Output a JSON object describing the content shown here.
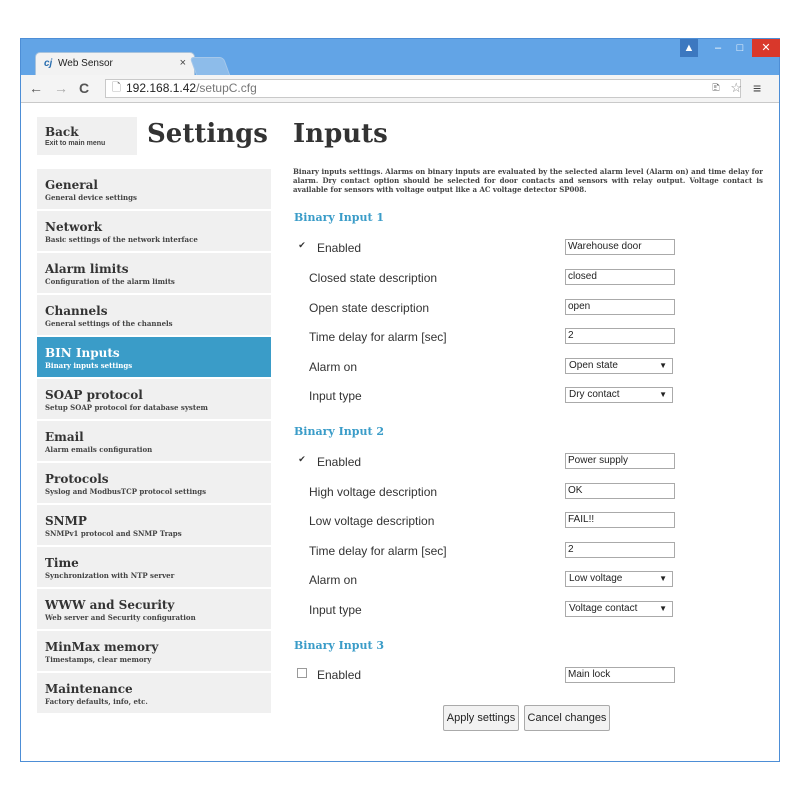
{
  "browser": {
    "tab_title": "Web Sensor",
    "tab_favicon": "cj",
    "tab_close_icon": "×",
    "back_icon": "←",
    "forward_icon": "→",
    "reload_icon": "C",
    "page_icon": "🗋",
    "url_host": "192.168.1.42",
    "url_path": "/setupC.cfg",
    "translate_icon": "🗈",
    "star_icon": "☆",
    "menu_icon": "≡",
    "user_icon": "▲",
    "minimize_icon": "–",
    "maximize_icon": "□",
    "close_icon": "✕"
  },
  "sidebar": {
    "back": {
      "label": "Back",
      "sublabel": "Exit to main menu"
    },
    "title": "Settings",
    "items": [
      {
        "label": "General",
        "sublabel": "General device settings"
      },
      {
        "label": "Network",
        "sublabel": "Basic settings of the network interface"
      },
      {
        "label": "Alarm limits",
        "sublabel": "Configuration of the alarm limits"
      },
      {
        "label": "Channels",
        "sublabel": "General settings of the channels"
      },
      {
        "label": "BIN Inputs",
        "sublabel": "Binary inputs settings"
      },
      {
        "label": "SOAP protocol",
        "sublabel": "Setup SOAP protocol for database system"
      },
      {
        "label": "Email",
        "sublabel": "Alarm emails configuration"
      },
      {
        "label": "Protocols",
        "sublabel": "Syslog and ModbusTCP protocol settings"
      },
      {
        "label": "SNMP",
        "sublabel": "SNMPv1 protocol and SNMP Traps"
      },
      {
        "label": "Time",
        "sublabel": "Synchronization with NTP server"
      },
      {
        "label": "WWW and Security",
        "sublabel": "Web server and Security configuration"
      },
      {
        "label": "MinMax memory",
        "sublabel": "Timestamps, clear memory"
      },
      {
        "label": "Maintenance",
        "sublabel": "Factory defaults, info, etc."
      }
    ]
  },
  "main": {
    "title": "Inputs",
    "description": "Binary inputs settings. Alarms on binary inputs are evaluated by the selected alarm level (Alarm on) and time delay for alarm. Dry contact option should be selected for door contacts and sensors with relay output. Voltage contact is available for sensors with voltage output like a AC voltage detector SP008.",
    "sections": [
      {
        "title": "Binary Input 1",
        "enabled_label": "Enabled",
        "enabled": true,
        "name_value": "Warehouse door",
        "fields": [
          {
            "label": "Closed state description",
            "value": "closed"
          },
          {
            "label": "Open state description",
            "value": "open"
          },
          {
            "label": "Time delay for alarm [sec]",
            "value": "2"
          }
        ],
        "alarm_on_label": "Alarm on",
        "alarm_on_value": "Open state",
        "input_type_label": "Input type",
        "input_type_value": "Dry contact"
      },
      {
        "title": "Binary Input 2",
        "enabled_label": "Enabled",
        "enabled": true,
        "name_value": "Power supply",
        "fields": [
          {
            "label": "High voltage description",
            "value": "OK"
          },
          {
            "label": "Low voltage description",
            "value": "FAIL!!"
          },
          {
            "label": "Time delay for alarm [sec]",
            "value": "2"
          }
        ],
        "alarm_on_label": "Alarm on",
        "alarm_on_value": "Low voltage",
        "input_type_label": "Input type",
        "input_type_value": "Voltage contact"
      },
      {
        "title": "Binary Input 3",
        "enabled_label": "Enabled",
        "enabled": false,
        "name_value": "Main lock"
      }
    ],
    "check_mark": "✔",
    "dropdown_arrow": "▼",
    "apply_label": "Apply settings",
    "cancel_label": "Cancel changes"
  },
  "colors": {
    "accent": "#3a9cc8",
    "chrome": "#62a4e6"
  }
}
